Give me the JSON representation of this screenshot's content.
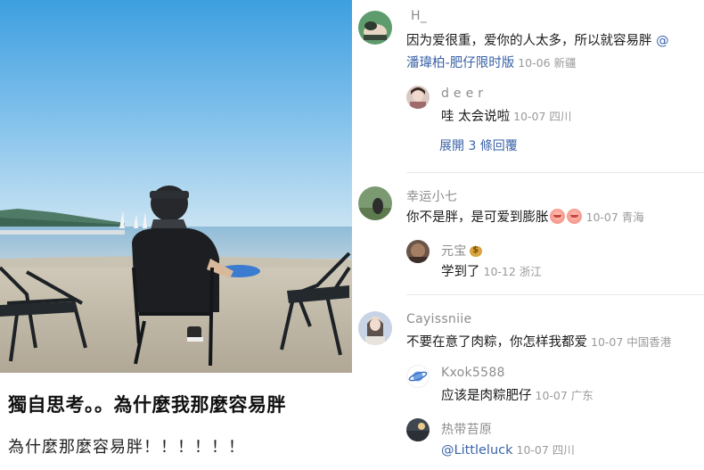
{
  "post": {
    "title": "獨自思考。。為什麼我那麼容易胖",
    "body": "為什麼那麼容易胖！！！！！！"
  },
  "comments": [
    {
      "user": "H_",
      "text": "因为爱很重，爱你的人太多，所以就容易胖",
      "mention_line1": "@",
      "mention_line2": "潘瑋柏-肥仔限时版",
      "meta": "10-06 新疆",
      "replies": [
        {
          "user": "d e e r",
          "text": "哇 太会说啦",
          "meta": "10-07 四川"
        }
      ],
      "expand_label": "展開 3 條回覆"
    },
    {
      "user": "幸运小七",
      "text": "你不是胖，是可爱到膨胀",
      "emoji": "face-emoji",
      "meta": "10-07 青海",
      "replies": [
        {
          "user": "元宝",
          "user_icon": "money-bag-icon",
          "text": "学到了",
          "meta": "10-12 浙江"
        }
      ]
    },
    {
      "user": "Cayissniie",
      "text": "不要在意了肉粽，你怎样我都爱",
      "meta": "10-07 中国香港",
      "replies": [
        {
          "user": "Kxok5588",
          "text": "应该是肉粽肥仔",
          "meta": "10-07 广东"
        },
        {
          "user": "热带苔原",
          "text": "@Littleluck",
          "meta": "10-07 四川"
        }
      ]
    }
  ],
  "colors": {
    "link": "#3a62a8",
    "meta": "#9a9a9a",
    "username": "#8c8c8c",
    "sky_top": "#3d9fe0",
    "sand": "#c2baa9"
  }
}
